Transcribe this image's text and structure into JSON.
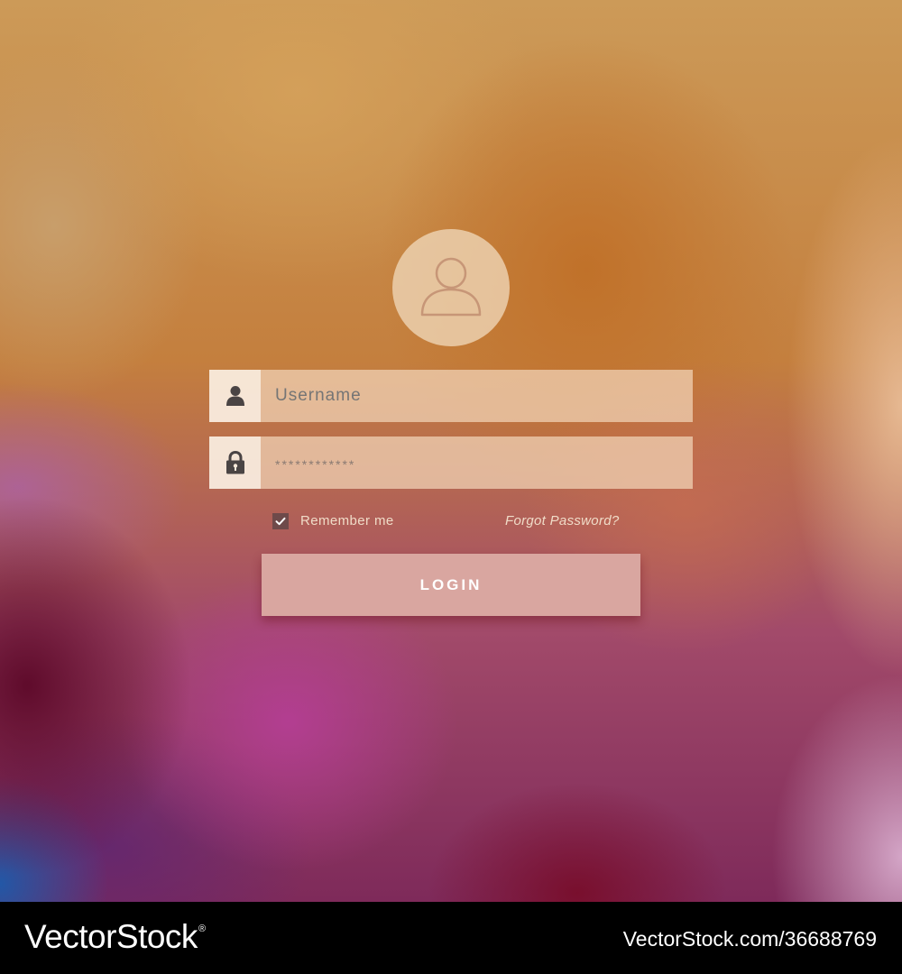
{
  "login_form": {
    "avatar_icon": "user-outline-icon",
    "username": {
      "icon": "user-icon",
      "placeholder": "Username",
      "value": ""
    },
    "password": {
      "icon": "lock-icon",
      "value": "************"
    },
    "remember_me": {
      "label": "Remember me",
      "checked": true
    },
    "forgot_password_label": "Forgot Password?",
    "login_label": "LOGIN"
  },
  "watermark": {
    "brand": "VectorStock",
    "brand_mark": "®",
    "image_id": "VectorStock.com/36688769"
  },
  "colors": {
    "button_fill": "#d9a6a0",
    "input_fill": "#f0d2b4",
    "icon_dark": "#4a4444",
    "checkbox_fill": "#6e4a4a"
  }
}
